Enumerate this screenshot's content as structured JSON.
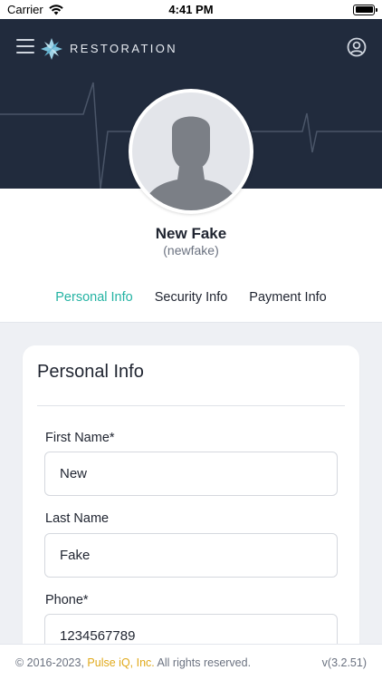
{
  "status_bar": {
    "carrier": "Carrier",
    "time": "4:41 PM",
    "icons": [
      "wifi-icon",
      "battery-icon"
    ]
  },
  "navbar": {
    "brand": "RESTORATION",
    "icons": [
      "menu-icon",
      "restoration-logo-icon",
      "account-icon"
    ]
  },
  "profile": {
    "name": "New Fake",
    "username": "(newfake)"
  },
  "tabs": [
    {
      "label": "Personal Info",
      "active": true
    },
    {
      "label": "Security Info",
      "active": false
    },
    {
      "label": "Payment Info",
      "active": false
    }
  ],
  "card": {
    "title": "Personal Info",
    "fields": [
      {
        "label": "First Name*",
        "value": "New"
      },
      {
        "label": "Last Name",
        "value": "Fake"
      },
      {
        "label": "Phone*",
        "value": "1234567789"
      }
    ]
  },
  "footer": {
    "copyright_prefix": "© 2016-2023, ",
    "company": "Pulse iQ, Inc.",
    "copyright_suffix": " All rights reserved.",
    "version": "v(3.2.51)"
  },
  "colors": {
    "header_bg": "#212b3d",
    "accent_teal": "#24b3a3",
    "company_link": "#e0a91a"
  }
}
